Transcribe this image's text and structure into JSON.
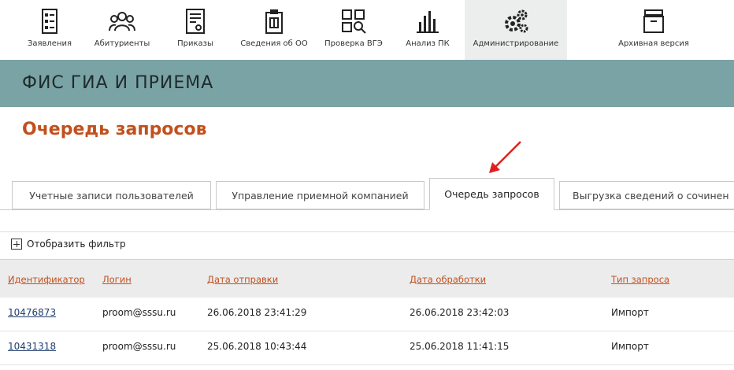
{
  "nav": {
    "items": [
      {
        "label": "Заявления",
        "icon": "applications-icon"
      },
      {
        "label": "Абитуриенты",
        "icon": "applicants-icon"
      },
      {
        "label": "Приказы",
        "icon": "orders-icon"
      },
      {
        "label": "Сведения об ОО",
        "icon": "organization-info-icon"
      },
      {
        "label": "Проверка ВГЭ",
        "icon": "check-grid-icon"
      },
      {
        "label": "Анализ ПК",
        "icon": "bar-chart-icon"
      },
      {
        "label": "Администрирование",
        "icon": "gears-icon"
      },
      {
        "label": "Архивная версия",
        "icon": "archive-icon"
      }
    ],
    "active_index": 6
  },
  "banner": {
    "title": "ФИС ГИА И ПРИЕМА"
  },
  "page": {
    "title": "Очередь запросов"
  },
  "tabs": [
    {
      "label": "Учетные записи пользователей"
    },
    {
      "label": "Управление приемной компанией"
    },
    {
      "label": "Очередь запросов"
    },
    {
      "label": "Выгрузка сведений о сочинен"
    }
  ],
  "active_tab": 2,
  "filter": {
    "label": "Отобразить фильтр"
  },
  "table": {
    "columns": [
      "Идентификатор",
      "Логин",
      "Дата отправки",
      "Дата обработки",
      "Тип запроса"
    ],
    "rows": [
      [
        "10476873",
        "proom@sssu.ru",
        "26.06.2018 23:41:29",
        "26.06.2018 23:42:03",
        "Импорт"
      ],
      [
        "10431318",
        "proom@sssu.ru",
        "25.06.2018 10:43:44",
        "25.06.2018 11:41:15",
        "Импорт"
      ]
    ]
  },
  "colors": {
    "accent": "#c2501d",
    "banner": "#7aa3a5",
    "link": "#1f3f6e",
    "arrow": "#e02020"
  }
}
